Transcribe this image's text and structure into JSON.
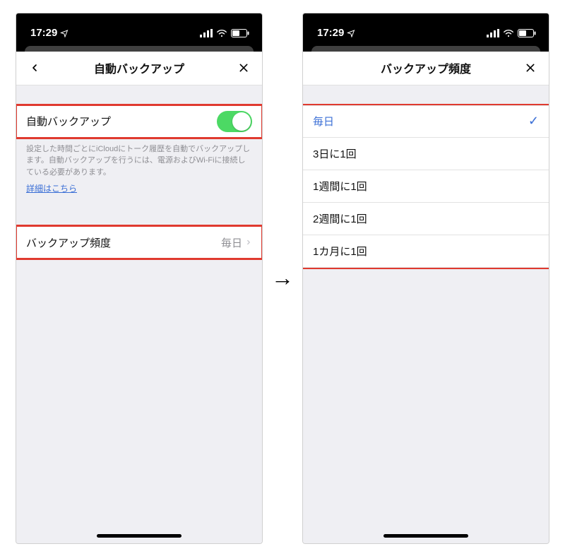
{
  "status": {
    "time": "17:29"
  },
  "screenA": {
    "nav_title": "自動バックアップ",
    "toggle_label": "自動バックアップ",
    "description": "設定した時間ごとにiCloudにトーク履歴を自動でバックアップします。自動バックアップを行うには、電源およびWi-Fiに接続している必要があります。",
    "details_link": "詳細はこちら",
    "freq_label": "バックアップ頻度",
    "freq_value": "毎日"
  },
  "screenB": {
    "nav_title": "バックアップ頻度",
    "options": {
      "o0": "毎日",
      "o1": "3日に1回",
      "o2": "1週間に1回",
      "o3": "2週間に1回",
      "o4": "1カ月に1回"
    },
    "selected_index": 0
  }
}
